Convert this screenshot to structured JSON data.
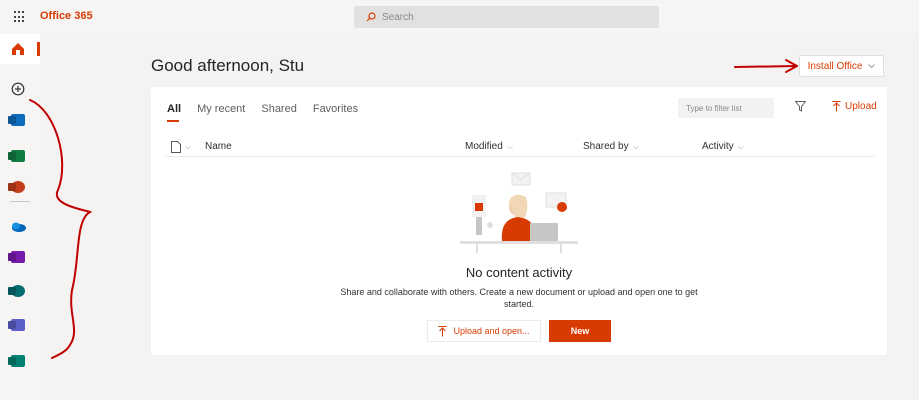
{
  "app": {
    "brand": "Office 365",
    "search_placeholder": "Search"
  },
  "rail": {
    "items": [
      {
        "name": "home",
        "color": "#d83b01"
      },
      {
        "name": "create",
        "color": "#323130"
      },
      {
        "name": "outlook",
        "color": "#0f6cbd"
      },
      {
        "name": "excel",
        "color": "#107c41"
      },
      {
        "name": "powerpoint",
        "color": "#c43e1c"
      },
      {
        "name": "onedrive",
        "color": "#0364b8"
      },
      {
        "name": "onenote",
        "color": "#7719aa"
      },
      {
        "name": "sharepoint",
        "color": "#036c70"
      },
      {
        "name": "teams",
        "color": "#5b5fc7"
      },
      {
        "name": "sway",
        "color": "#008272"
      }
    ]
  },
  "main": {
    "greeting": "Good afternoon, Stu",
    "install_label": "Install Office",
    "tabs": [
      {
        "label": "All",
        "active": true
      },
      {
        "label": "My recent",
        "active": false
      },
      {
        "label": "Shared",
        "active": false
      },
      {
        "label": "Favorites",
        "active": false
      }
    ],
    "filter_placeholder": "Type to filter list",
    "upload_label": "Upload",
    "columns": {
      "name": "Name",
      "modified": "Modified",
      "shared_by": "Shared by",
      "activity": "Activity"
    },
    "empty_title": "No content activity",
    "empty_desc": "Share and collaborate with others. Create a new document or upload and open one to get started.",
    "upload_open_label": "Upload and open...",
    "new_label": "New"
  },
  "colors": {
    "accent": "#d83b01",
    "annotation": "#c00000"
  }
}
